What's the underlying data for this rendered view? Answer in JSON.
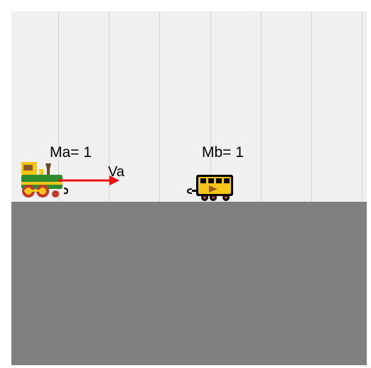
{
  "header": {
    "partial_text": ""
  },
  "labels": {
    "mass_a": "Ma= 1",
    "mass_b": "Mb= 1",
    "velocity_a": "Va"
  },
  "colors": {
    "background": "#f0f0f0",
    "ground": "#808080",
    "arrow": "#ee1111",
    "engine_green": "#2e8b2e",
    "engine_yellow": "#f5c518",
    "car_yellow": "#f5c518"
  },
  "icons": {
    "object_a": "locomotive-icon",
    "object_b": "railcar-icon"
  }
}
